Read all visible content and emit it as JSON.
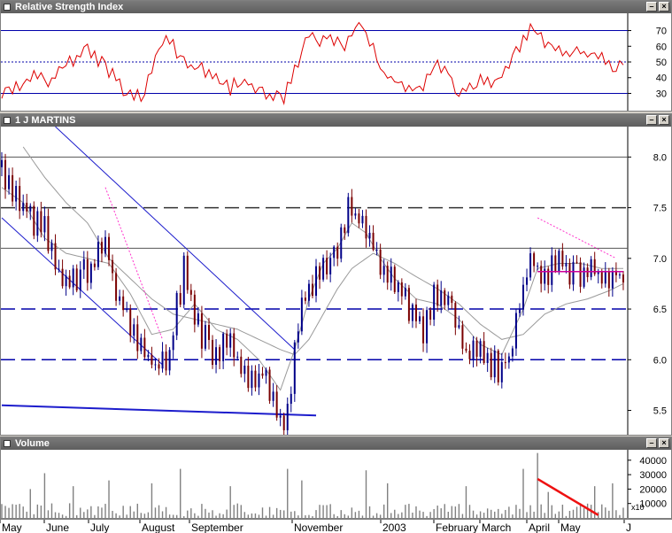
{
  "colors": {
    "rsi_line": "#dd0000",
    "guide_blue": "#0000aa",
    "channel_blue": "#1c1ccc",
    "bar_down": "#7a0000",
    "bar_up": "#000088",
    "ma_gray": "#9a9a9a",
    "volume_bar": "#808080",
    "trend_red": "#ee1111",
    "pink_dotted": "#ff33cc",
    "magenta_level": "#cc0099"
  },
  "panels": {
    "rsi": {
      "title": "Relative Strength Index"
    },
    "price": {
      "title": "1 J MARTINS"
    },
    "volume": {
      "title": "Volume",
      "multiplier": "x10"
    }
  },
  "window_buttons": {
    "minimize": "–",
    "close": "×"
  },
  "date_axis": {
    "labels": [
      "May",
      "June",
      "July",
      "August",
      "September",
      "November",
      "2003",
      "February",
      "March",
      "April",
      "May",
      "J"
    ]
  },
  "chart_data": [
    {
      "type": "line",
      "name": "Relative Strength Index",
      "y_ticks": [
        30,
        40,
        50,
        60,
        70
      ],
      "ylim": [
        19,
        81
      ],
      "reference_lines": [
        30,
        50,
        70
      ],
      "anchors": [
        [
          0,
          31
        ],
        [
          6,
          37
        ],
        [
          10,
          46
        ],
        [
          14,
          40
        ],
        [
          18,
          52
        ],
        [
          24,
          60
        ],
        [
          28,
          52
        ],
        [
          31,
          45
        ],
        [
          35,
          32
        ],
        [
          39,
          30
        ],
        [
          44,
          62
        ],
        [
          47,
          67
        ],
        [
          50,
          55
        ],
        [
          54,
          48
        ],
        [
          57,
          47
        ],
        [
          61,
          40
        ],
        [
          64,
          36
        ],
        [
          67,
          42
        ],
        [
          72,
          34
        ],
        [
          76,
          31
        ],
        [
          79,
          30
        ],
        [
          83,
          54
        ],
        [
          86,
          71
        ],
        [
          89,
          66
        ],
        [
          92,
          68
        ],
        [
          95,
          62
        ],
        [
          98,
          70
        ],
        [
          101,
          76
        ],
        [
          104,
          60
        ],
        [
          107,
          45
        ],
        [
          110,
          42
        ],
        [
          113,
          38
        ],
        [
          116,
          35
        ],
        [
          119,
          41
        ],
        [
          122,
          52
        ],
        [
          125,
          46
        ],
        [
          128,
          32
        ],
        [
          131,
          38
        ],
        [
          134,
          42
        ],
        [
          137,
          38
        ],
        [
          140,
          44
        ],
        [
          143,
          55
        ],
        [
          146,
          68
        ],
        [
          149,
          74
        ],
        [
          152,
          65
        ],
        [
          156,
          62
        ],
        [
          159,
          56
        ],
        [
          162,
          60
        ],
        [
          165,
          54
        ],
        [
          168,
          55
        ],
        [
          171,
          48
        ],
        [
          174,
          51
        ]
      ]
    },
    {
      "type": "ohlc",
      "name": "1 J MARTINS",
      "y_ticks": [
        5.5,
        6.0,
        6.5,
        7.0,
        7.5,
        8.0
      ],
      "ylim": [
        5.26,
        8.3
      ],
      "dashed_levels": [
        6.0,
        6.5,
        7.5
      ],
      "solid_levels": [
        7.1,
        8.0
      ],
      "anchors": [
        [
          0,
          7.9
        ],
        [
          4,
          7.75
        ],
        [
          8,
          7.5
        ],
        [
          12,
          7.35
        ],
        [
          16,
          6.9
        ],
        [
          19,
          6.85
        ],
        [
          22,
          6.95
        ],
        [
          25,
          7.0
        ],
        [
          29,
          7.2
        ],
        [
          32,
          6.8
        ],
        [
          35,
          6.5
        ],
        [
          38,
          6.3
        ],
        [
          41,
          6.1
        ],
        [
          44,
          6.0
        ],
        [
          47,
          6.1
        ],
        [
          49,
          6.6
        ],
        [
          51,
          6.95
        ],
        [
          53,
          6.7
        ],
        [
          55,
          6.4
        ],
        [
          58,
          6.2
        ],
        [
          61,
          6.15
        ],
        [
          64,
          6.3
        ],
        [
          67,
          6.0
        ],
        [
          70,
          5.85
        ],
        [
          73,
          5.95
        ],
        [
          75,
          5.75
        ],
        [
          77,
          5.6
        ],
        [
          79,
          5.45
        ],
        [
          81,
          5.8
        ],
        [
          83,
          6.4
        ],
        [
          86,
          6.8
        ],
        [
          89,
          7.0
        ],
        [
          92,
          7.1
        ],
        [
          95,
          7.3
        ],
        [
          97,
          7.55
        ],
        [
          100,
          7.5
        ],
        [
          103,
          7.25
        ],
        [
          106,
          7.0
        ],
        [
          109,
          6.85
        ],
        [
          112,
          6.75
        ],
        [
          115,
          6.55
        ],
        [
          118,
          6.35
        ],
        [
          121,
          6.7
        ],
        [
          124,
          6.65
        ],
        [
          127,
          6.4
        ],
        [
          130,
          6.1
        ],
        [
          133,
          6.15
        ],
        [
          136,
          6.05
        ],
        [
          139,
          6.0
        ],
        [
          142,
          6.1
        ],
        [
          145,
          6.6
        ],
        [
          148,
          7.05
        ],
        [
          150,
          7.0
        ],
        [
          153,
          6.95
        ],
        [
          156,
          7.05
        ],
        [
          159,
          6.95
        ],
        [
          162,
          6.92
        ],
        [
          165,
          7.0
        ],
        [
          168,
          6.88
        ],
        [
          171,
          6.95
        ],
        [
          174,
          6.9
        ]
      ],
      "ma_fast_anchors": [
        [
          0,
          7.7
        ],
        [
          6,
          7.55
        ],
        [
          12,
          7.2
        ],
        [
          18,
          7.05
        ],
        [
          24,
          7.0
        ],
        [
          30,
          6.95
        ],
        [
          36,
          6.65
        ],
        [
          42,
          6.25
        ],
        [
          48,
          6.3
        ],
        [
          54,
          6.55
        ],
        [
          60,
          6.3
        ],
        [
          66,
          6.2
        ],
        [
          72,
          6.0
        ],
        [
          78,
          5.7
        ],
        [
          82,
          6.1
        ],
        [
          86,
          6.6
        ],
        [
          90,
          6.95
        ],
        [
          94,
          7.1
        ],
        [
          98,
          7.35
        ],
        [
          102,
          7.25
        ],
        [
          106,
          7.0
        ],
        [
          110,
          6.8
        ],
        [
          116,
          6.6
        ],
        [
          122,
          6.55
        ],
        [
          128,
          6.4
        ],
        [
          134,
          6.15
        ],
        [
          140,
          6.05
        ],
        [
          146,
          6.5
        ],
        [
          150,
          6.9
        ],
        [
          156,
          6.95
        ],
        [
          162,
          6.95
        ],
        [
          168,
          6.9
        ],
        [
          174,
          6.9
        ]
      ],
      "ma_slow_anchors": [
        [
          6,
          8.1
        ],
        [
          12,
          7.8
        ],
        [
          18,
          7.55
        ],
        [
          24,
          7.35
        ],
        [
          30,
          7.0
        ],
        [
          36,
          6.8
        ],
        [
          42,
          6.6
        ],
        [
          48,
          6.45
        ],
        [
          54,
          6.4
        ],
        [
          60,
          6.35
        ],
        [
          66,
          6.3
        ],
        [
          72,
          6.2
        ],
        [
          78,
          6.1
        ],
        [
          82,
          6.05
        ],
        [
          86,
          6.2
        ],
        [
          90,
          6.45
        ],
        [
          94,
          6.7
        ],
        [
          98,
          6.9
        ],
        [
          104,
          7.05
        ],
        [
          110,
          6.95
        ],
        [
          116,
          6.82
        ],
        [
          122,
          6.7
        ],
        [
          128,
          6.55
        ],
        [
          134,
          6.35
        ],
        [
          140,
          6.2
        ],
        [
          146,
          6.25
        ],
        [
          152,
          6.45
        ],
        [
          158,
          6.55
        ],
        [
          164,
          6.6
        ],
        [
          170,
          6.68
        ],
        [
          174,
          6.75
        ]
      ],
      "channel_upper": [
        [
          15,
          8.3
        ],
        [
          82,
          6.1
        ]
      ],
      "channel_lower": [
        [
          0,
          7.4
        ],
        [
          45,
          5.95
        ]
      ],
      "support_line": [
        [
          0,
          5.55
        ],
        [
          88,
          5.45
        ]
      ],
      "pink_trend_1": [
        [
          29,
          7.7
        ],
        [
          45,
          6.2
        ]
      ],
      "pink_trend_2": [
        [
          150,
          7.4
        ],
        [
          172,
          7.0
        ]
      ],
      "magenta_level": [
        [
          150,
          6.87
        ],
        [
          174,
          6.87
        ]
      ]
    },
    {
      "type": "bar",
      "name": "Volume",
      "y_ticks": [
        10000,
        20000,
        30000,
        40000
      ],
      "ylim": [
        0,
        46000
      ],
      "spikes": [
        [
          8,
          20000
        ],
        [
          12,
          31000
        ],
        [
          20,
          22000
        ],
        [
          30,
          26000
        ],
        [
          42,
          24000
        ],
        [
          50,
          34000
        ],
        [
          64,
          22000
        ],
        [
          80,
          34000
        ],
        [
          84,
          26000
        ],
        [
          102,
          33000
        ],
        [
          108,
          24000
        ],
        [
          130,
          22000
        ],
        [
          146,
          34000
        ],
        [
          150,
          45000
        ],
        [
          153,
          18000
        ],
        [
          166,
          22000
        ],
        [
          171,
          24000
        ]
      ],
      "trend_line": [
        [
          150,
          27000
        ],
        [
          167,
          2000
        ]
      ]
    }
  ]
}
